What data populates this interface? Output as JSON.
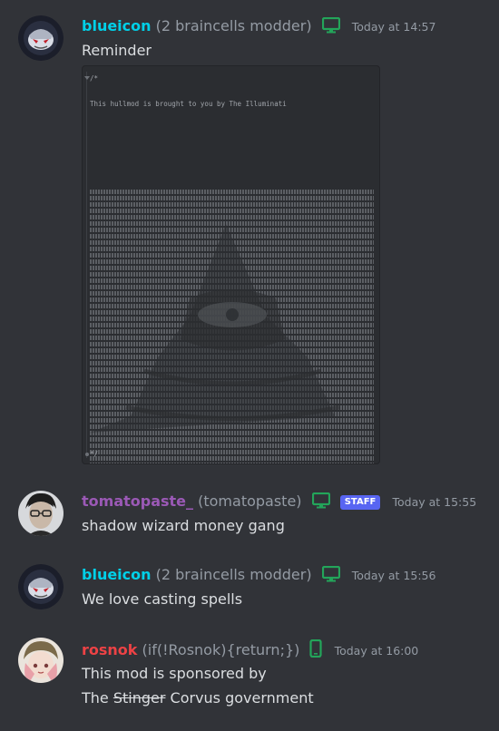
{
  "messages": [
    {
      "username": "blueicon",
      "subtitle": "(2 braincells modder)",
      "timestamp": "Today at 14:57",
      "device": "desktop",
      "text": "Reminder",
      "name_color": "#00d0e8"
    },
    {
      "code_open": "/*",
      "code_text": "This hullmod is brought to you by The Illuminati",
      "code_close": "*/"
    },
    {
      "username": "tomatopaste_",
      "subtitle": "(tomatopaste)",
      "timestamp": "Today at 15:55",
      "device": "desktop",
      "badge": "STAFF",
      "text": "shadow wizard money gang",
      "name_color": "#9b59b6"
    },
    {
      "username": "blueicon",
      "subtitle": "(2 braincells modder)",
      "timestamp": "Today at 15:56",
      "device": "desktop",
      "text": "We love casting spells",
      "name_color": "#00d0e8"
    },
    {
      "username": "rosnok",
      "subtitle": "(if(!Rosnok){return;})",
      "timestamp": "Today at 16:00",
      "device": "mobile",
      "text_line1": "This mod is sponsored by",
      "text_line2_a": "The ",
      "text_line2_strike": "Stinger",
      "text_line2_b": " Corvus government",
      "name_color": "#ed4245"
    }
  ],
  "colors": {
    "background": "#313338",
    "status_online": "#23a55a",
    "staff_badge": "#5865f2"
  }
}
